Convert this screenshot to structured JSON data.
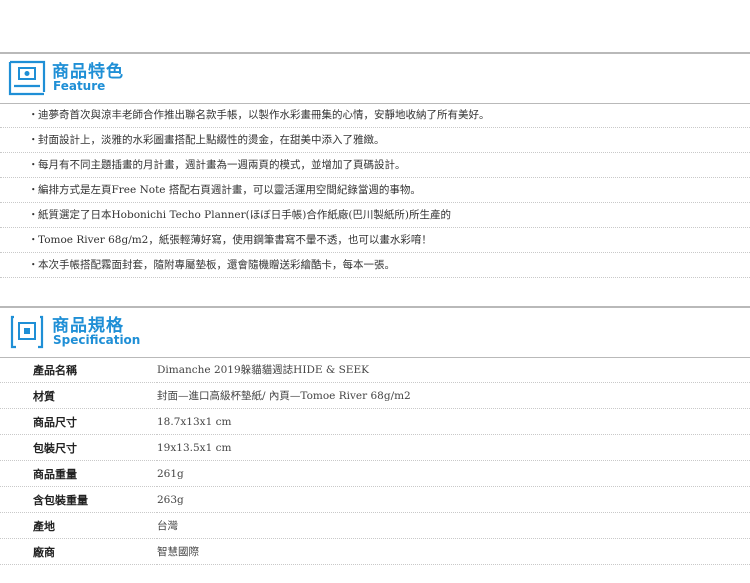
{
  "feature_section": {
    "title_zh": "商品特色",
    "title_en": "Feature",
    "items": [
      "迪夢奇首次與涼丰老師合作推出聯名款手帳，以製作水彩畫冊集的心情，安靜地收納了所有美好。",
      "封面設計上，淡雅的水彩圖畫搭配上點綴性的燙金，在甜美中添入了雅緻。",
      "每月有不同主題插畫的月計畫，週計畫為一週兩頁的模式，並增加了頁碼設計。",
      "編排方式是左頁Free Note 搭配右頁週計畫，可以靈活運用空間紀錄當週的事物。",
      "紙質選定了日本Hobonichi Techo Planner(ほぼ日手帳)合作紙廠(巴川製紙所)所生產的",
      "Tomoe River 68g/m2，紙張輕薄好寫，使用鋼筆書寫不暈不透，也可以畫水彩唷！",
      "本次手帳搭配霧面封套，隨附專屬墊板，還會隨機贈送彩繪酷卡，每本一張。"
    ]
  },
  "spec_section": {
    "title_zh": "商品規格",
    "title_en": "Specification",
    "rows": [
      {
        "label": "產品名稱",
        "value": "Dimanche 2019躲貓貓週誌HIDE & SEEK"
      },
      {
        "label": "材質",
        "value": "封面—進口高級杯墊紙/ 內頁—Tomoe River 68g/m2"
      },
      {
        "label": "商品尺寸",
        "value": "18.7x13x1 cm"
      },
      {
        "label": "包裝尺寸",
        "value": "19x13.5x1 cm"
      },
      {
        "label": "商品重量",
        "value": "261g"
      },
      {
        "label": "含包裝重量",
        "value": "263g"
      },
      {
        "label": "產地",
        "value": "台灣"
      },
      {
        "label": "廠商",
        "value": "智慧國際"
      }
    ]
  },
  "colors": {
    "accent": "#1f8fd6",
    "rule": "#b9b9b9"
  }
}
